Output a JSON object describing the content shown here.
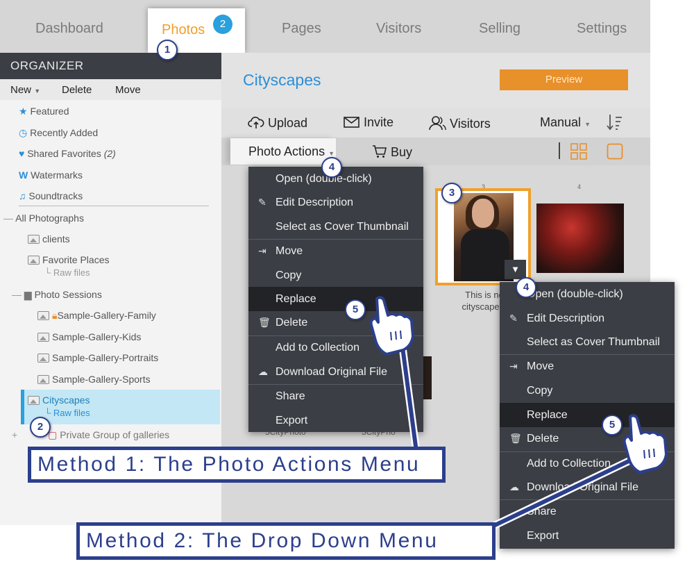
{
  "nav": {
    "tabs": [
      "Dashboard",
      "Photos",
      "Pages",
      "Visitors",
      "Selling",
      "Settings"
    ],
    "active": "Photos",
    "badge": "2"
  },
  "sidebar": {
    "header": "ORGANIZER",
    "actions": [
      "New",
      "Delete",
      "Move"
    ],
    "shortcuts": [
      "Featured",
      "Recently Added",
      "Shared Favorites",
      "Watermarks",
      "Soundtracks"
    ],
    "shared_count": "(2)",
    "all_photographs": "All Photographs",
    "galleries": {
      "clients": "clients",
      "favorite_places": "Favorite Places",
      "raw_files": "Raw files",
      "photo_sessions": "Photo Sessions",
      "family": "Sample-Gallery-Family",
      "kids": "Sample-Gallery-Kids",
      "portraits": "Sample-Gallery-Portraits",
      "sports": "Sample-Gallery-Sports",
      "cityscapes": "Cityscapes",
      "cityscapes_sub": "Raw files",
      "private_group": "Private Group of galleries"
    }
  },
  "main": {
    "gallery_title": "Cityscapes",
    "preview": "Preview",
    "toolbar": {
      "upload": "Upload",
      "invite": "Invite",
      "visitors": "Visitors",
      "sort": "Manual"
    },
    "photo_actions": "Photo Actions",
    "buy": "Buy",
    "photos": {
      "num3": "3",
      "num4": "4",
      "caption_line1": "This is no",
      "caption_line2": "cityscape p",
      "cap_a": "5CityPhoto",
      "cap_b": "5CityPho"
    }
  },
  "menu1": [
    "Open (double-click)",
    "Edit Description",
    "Select as Cover Thumbnail",
    "Move",
    "Copy",
    "Replace",
    "Delete",
    "Add to Collection",
    "Download Original File",
    "Share",
    "Export"
  ],
  "menu2": [
    "Open (double-click)",
    "Edit Description",
    "Select as Cover Thumbnail",
    "Move",
    "Copy",
    "Replace",
    "Delete",
    "Add to Collection",
    "Download Original File",
    "Share",
    "Export"
  ],
  "callouts": [
    "1",
    "2",
    "3",
    "4",
    "4",
    "5",
    "5"
  ],
  "banners": {
    "method1": "Method 1: The Photo Actions Menu",
    "method2": "Method 2: The Drop Down Menu"
  },
  "colors": {
    "accent_orange": "#f0a02a",
    "accent_blue": "#2a8fd8",
    "annotation_navy": "#2c3f8c",
    "menu_bg": "#3b3e44"
  },
  "icons": [
    "star-icon",
    "clock-icon",
    "heart-icon",
    "watermark-icon",
    "music-icon",
    "gallery-icon",
    "folder-icon",
    "lock-icon",
    "upload-cloud-icon",
    "envelope-icon",
    "visitors-icon",
    "sort-icon",
    "cart-icon",
    "grid-view-icon",
    "single-view-icon",
    "pencil-icon",
    "move-icon",
    "trash-icon",
    "download-icon",
    "hand-pointer-icon"
  ]
}
